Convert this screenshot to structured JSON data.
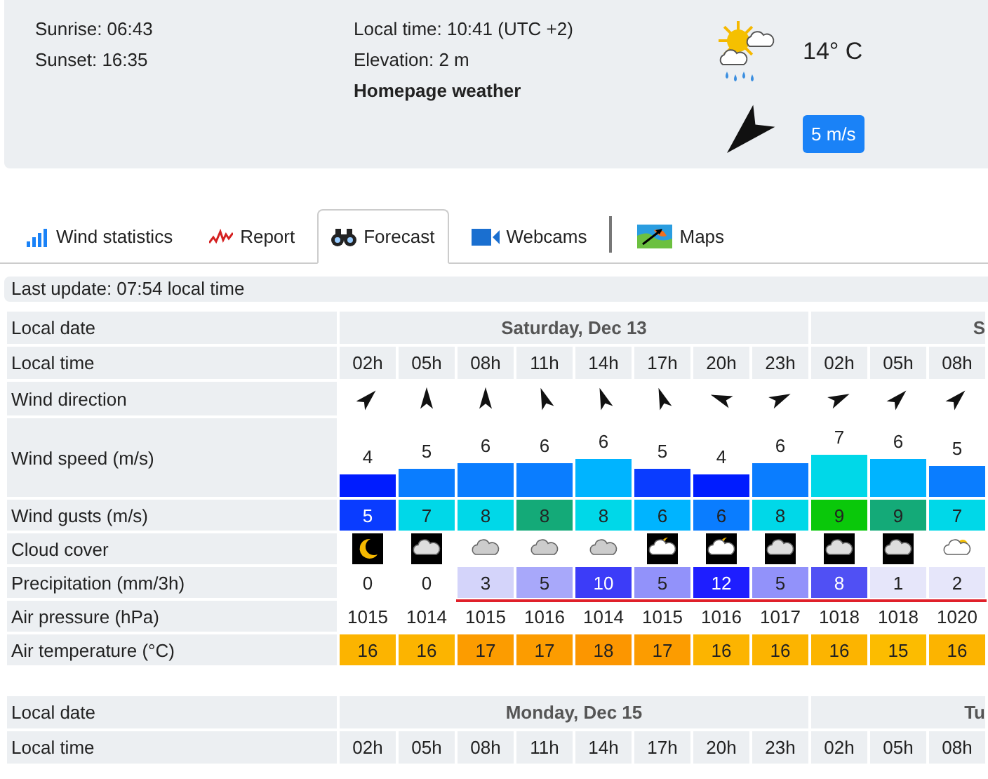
{
  "header": {
    "sunrise": "Sunrise: 06:43",
    "sunset": "Sunset: 16:35",
    "local_time": "Local time: 10:41 (UTC +2)",
    "elevation": "Elevation: 2 m",
    "homepage_link": "Homepage weather",
    "temperature": "14° C",
    "wind_badge": "5 m/s"
  },
  "tabs": [
    {
      "label": "Wind statistics",
      "kind": "stats",
      "selected": false
    },
    {
      "label": "Report",
      "kind": "report",
      "selected": false
    },
    {
      "label": "Forecast",
      "kind": "forecast",
      "selected": true
    },
    {
      "label": "Webcams",
      "kind": "webcams",
      "selected": false
    },
    {
      "label": "Maps",
      "kind": "maps",
      "selected": false
    }
  ],
  "last_update": "Last update: 07:54 local time",
  "tables": [
    {
      "date_label": "Local date",
      "time_label": "Local time",
      "days": [
        {
          "label": "Saturday, Dec 13",
          "hours": [
            "02h",
            "05h",
            "08h",
            "11h",
            "14h",
            "17h",
            "20h",
            "23h"
          ]
        },
        {
          "label": "S",
          "hours": [
            "02h",
            "05h",
            "08h"
          ]
        }
      ],
      "rows": [
        {
          "kind": "direction",
          "label": "Wind direction"
        },
        {
          "kind": "speed",
          "label": "Wind speed (m/s)",
          "cells": [
            {
              "value": "4",
              "color": "#001cff"
            },
            {
              "value": "5",
              "color": "#0a7dff"
            },
            {
              "value": "6",
              "color": "#0a7dff"
            },
            {
              "value": "6",
              "color": "#0a7dff"
            },
            {
              "value": "6",
              "color": "#00b4ff"
            },
            {
              "value": "5",
              "color": "#0a3cff"
            },
            {
              "value": "4",
              "color": "#001cff"
            },
            {
              "value": "6",
              "color": "#0a7dff"
            },
            {
              "value": "7",
              "color": "#00d8e8"
            },
            {
              "value": "6",
              "color": "#00b4ff"
            },
            {
              "value": "5",
              "color": "#0a7dff"
            }
          ]
        },
        {
          "kind": "colored",
          "label": "Wind gusts (m/s)",
          "cells": [
            {
              "value": "5",
              "color": "#0a3cff"
            },
            {
              "value": "7",
              "color": "#00d8e8"
            },
            {
              "value": "8",
              "color": "#00d8e8"
            },
            {
              "value": "8",
              "color": "#14aa78"
            },
            {
              "value": "8",
              "color": "#00d8e8"
            },
            {
              "value": "6",
              "color": "#00b4ff"
            },
            {
              "value": "6",
              "color": "#0a7dff"
            },
            {
              "value": "8",
              "color": "#00d8e8"
            },
            {
              "value": "9",
              "color": "#0ac80a"
            },
            {
              "value": "9",
              "color": "#14aa78"
            },
            {
              "value": "7",
              "color": "#00d8e8"
            }
          ]
        },
        {
          "kind": "cloud",
          "label": "Cloud cover"
        },
        {
          "kind": "precip",
          "label": "Precipitation (mm/3h)",
          "cells": [
            {
              "value": "0",
              "color": "#ffffff",
              "underlined": false
            },
            {
              "value": "0",
              "color": "#ffffff",
              "underlined": false
            },
            {
              "value": "3",
              "color": "#d4d4fa",
              "underlined": true
            },
            {
              "value": "5",
              "color": "#a8a8fa",
              "underlined": true
            },
            {
              "value": "10",
              "color": "#3c3cf8",
              "underlined": true
            },
            {
              "value": "5",
              "color": "#9292fa",
              "underlined": true
            },
            {
              "value": "12",
              "color": "#1e1eff",
              "underlined": true
            },
            {
              "value": "5",
              "color": "#9292fa",
              "underlined": true
            },
            {
              "value": "8",
              "color": "#5050f4",
              "underlined": true
            },
            {
              "value": "1",
              "color": "#e6e6fa",
              "underlined": true
            },
            {
              "value": "2",
              "color": "#e6e6fa",
              "underlined": true
            }
          ]
        },
        {
          "kind": "plain",
          "label": "Air pressure (hPa)",
          "cells": [
            {
              "value": "1015"
            },
            {
              "value": "1014"
            },
            {
              "value": "1015"
            },
            {
              "value": "1016"
            },
            {
              "value": "1014"
            },
            {
              "value": "1015"
            },
            {
              "value": "1016"
            },
            {
              "value": "1017"
            },
            {
              "value": "1018"
            },
            {
              "value": "1018"
            },
            {
              "value": "1020"
            }
          ]
        },
        {
          "kind": "colored",
          "label": "Air temperature (°C)",
          "cells": [
            {
              "value": "16",
              "color": "#fcb400"
            },
            {
              "value": "16",
              "color": "#fcb400"
            },
            {
              "value": "17",
              "color": "#fc9c00"
            },
            {
              "value": "17",
              "color": "#fc9c00"
            },
            {
              "value": "18",
              "color": "#fc9600"
            },
            {
              "value": "17",
              "color": "#fc9c00"
            },
            {
              "value": "16",
              "color": "#fcb400"
            },
            {
              "value": "16",
              "color": "#fcb400"
            },
            {
              "value": "16",
              "color": "#fcb400"
            },
            {
              "value": "15",
              "color": "#fcbc00"
            },
            {
              "value": "16",
              "color": "#fcb400"
            }
          ]
        }
      ]
    },
    {
      "date_label": "Local date",
      "time_label": "Local time",
      "days": [
        {
          "label": "Monday, Dec 15",
          "hours": [
            "02h",
            "05h",
            "08h",
            "11h",
            "14h",
            "17h",
            "20h",
            "23h"
          ]
        },
        {
          "label": "Tu",
          "hours": [
            "02h",
            "05h",
            "08h"
          ]
        }
      ]
    }
  ]
}
